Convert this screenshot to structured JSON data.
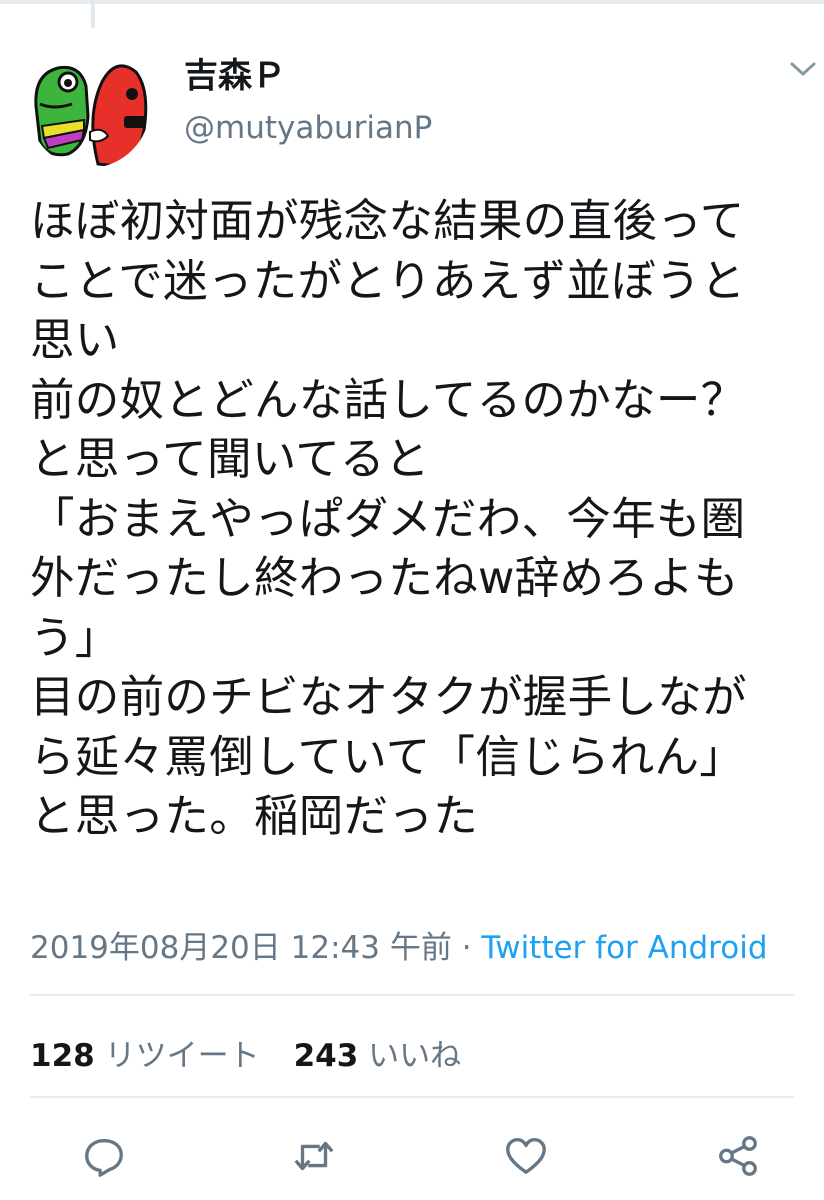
{
  "tweet": {
    "display_name": "吉森Ｐ",
    "handle": "@mutyaburianP",
    "text": "ほぼ初対面が残念な結果の直後って\nことで迷ったがとりあえず並ぼうと\n思い\n前の奴とどんな話してるのかなー？\nと思って聞いてると\n「おまえやっぱダメだわ、今年も圏\n外だったし終わったねw辞めろよも\nう」\n目の前のチビなオタクが握手しなが\nら延々罵倒していて「信じられん」\nと思った。稲岡だった",
    "timestamp": "2019年08月20日 12:43 午前",
    "separator": " · ",
    "source": "Twitter for Android"
  },
  "stats": {
    "retweet_count": "128",
    "retweet_label": "リツイート",
    "like_count": "243",
    "like_label": "いいね"
  },
  "icons": {
    "caret": "chevron-down-icon",
    "reply": "reply-icon",
    "retweet": "retweet-icon",
    "like": "heart-icon",
    "share": "share-icon"
  },
  "colors": {
    "text": "#14171a",
    "secondary": "#657786",
    "link": "#1da1f2",
    "divider": "#e6ecf0"
  }
}
